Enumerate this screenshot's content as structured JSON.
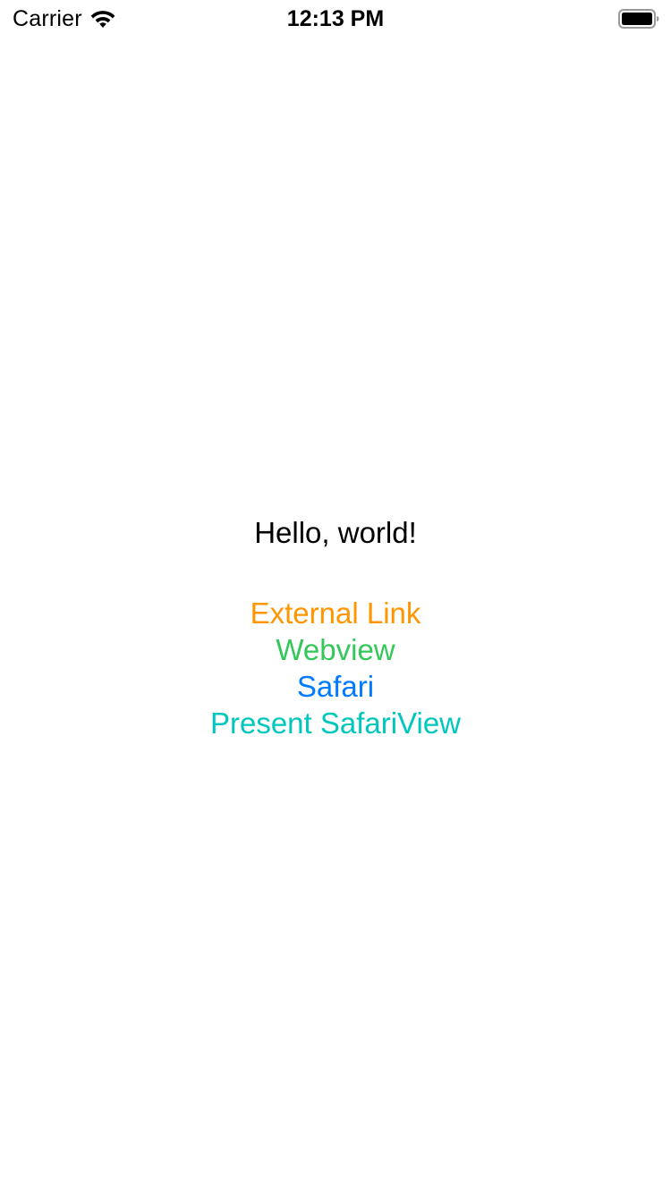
{
  "status_bar": {
    "carrier": "Carrier",
    "time": "12:13 PM",
    "icons": [
      "wifi-icon",
      "battery-icon"
    ]
  },
  "main": {
    "greeting": "Hello, world!",
    "links": [
      {
        "label": "External Link",
        "color": "#FF9500"
      },
      {
        "label": "Webview",
        "color": "#34C759"
      },
      {
        "label": "Safari",
        "color": "#007AFF"
      },
      {
        "label": "Present SafariView",
        "color": "#00C7BE"
      }
    ]
  }
}
